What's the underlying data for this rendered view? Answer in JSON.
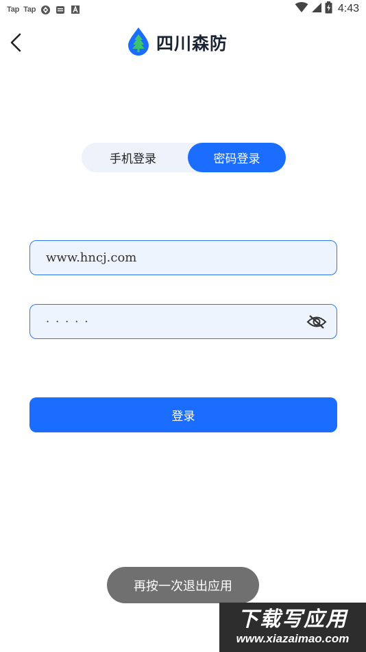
{
  "status_bar": {
    "left_items": [
      "Tap",
      "Tap"
    ],
    "left_icons": [
      "game-controller-icon",
      "message-icon",
      "font-a-icon"
    ],
    "right_icons": [
      "wifi-icon",
      "signal-icon",
      "battery-charging-icon"
    ],
    "time": "4:43"
  },
  "header": {
    "back_icon": "chevron-left-icon",
    "logo_icon": "tree-drop-logo-icon",
    "title": "四川森防"
  },
  "tabs": [
    {
      "label": "手机登录",
      "active": false
    },
    {
      "label": "密码登录",
      "active": true
    }
  ],
  "form": {
    "username": {
      "value": "www.hncj.com",
      "placeholder": ""
    },
    "password": {
      "value": "·····",
      "placeholder": ""
    },
    "eye_icon": "eye-off-icon",
    "login_label": "登录"
  },
  "toast": {
    "text": "再按一次退出应用"
  },
  "watermark": {
    "title": "下载写应用",
    "url": "www.xiazaimao.com"
  },
  "colors": {
    "primary": "#1a6dff",
    "field_bg": "#eef4fd",
    "field_border": "#2b78f0",
    "tab_bg": "#eef3fb",
    "toast_bg": "#707070"
  }
}
